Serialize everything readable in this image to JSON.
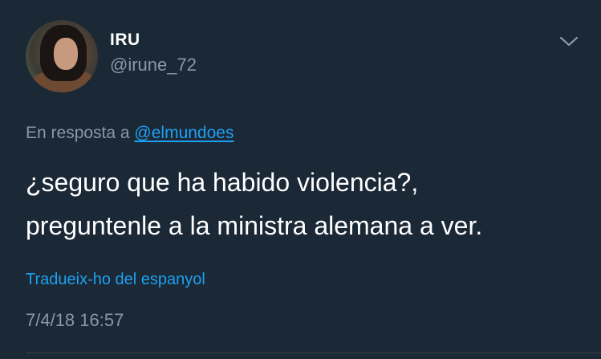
{
  "author": {
    "name": "IRU",
    "handle": "@irune_72"
  },
  "reply_context": {
    "prefix": "En resposta a ",
    "mention": "@elmundoes"
  },
  "tweet": {
    "line1": "¿seguro que ha habido violencia?,",
    "line2": "preguntenle a la ministra alemana a ver."
  },
  "translate_link": "Tradueix-ho del espanyol",
  "timestamp": "7/4/18 16:57",
  "icons": {
    "menu": "chevron-down-icon",
    "avatar": "profile-photo"
  },
  "colors": {
    "background": "#1b2836",
    "text": "#ffffff",
    "secondary": "#8899a6",
    "link": "#1da1f2"
  }
}
